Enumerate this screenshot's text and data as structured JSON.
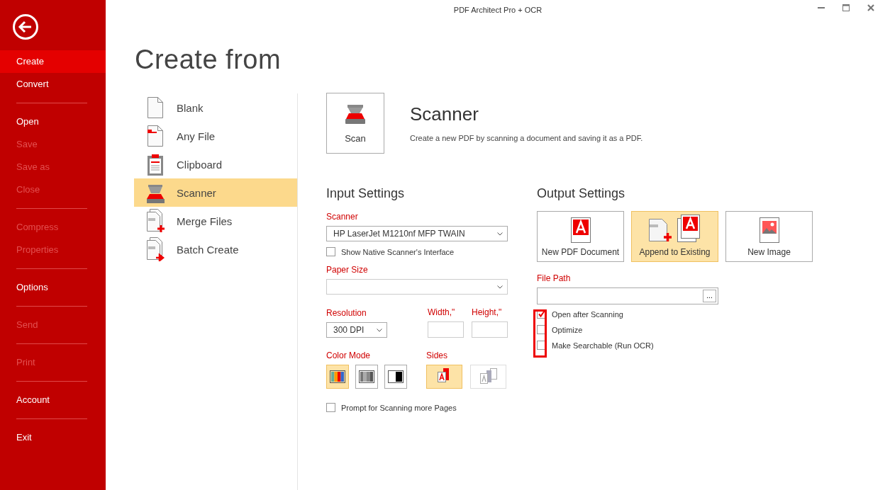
{
  "window": {
    "title": "PDF Architect Pro + OCR"
  },
  "sidebar": {
    "groups": [
      [
        {
          "label": "Create",
          "selected": true,
          "disabled": false
        },
        {
          "label": "Convert",
          "selected": false,
          "disabled": false
        }
      ],
      [
        {
          "label": "Open",
          "selected": false,
          "disabled": false
        },
        {
          "label": "Save",
          "selected": false,
          "disabled": true
        },
        {
          "label": "Save as",
          "selected": false,
          "disabled": true
        },
        {
          "label": "Close",
          "selected": false,
          "disabled": true
        }
      ],
      [
        {
          "label": "Compress",
          "selected": false,
          "disabled": true
        },
        {
          "label": "Properties",
          "selected": false,
          "disabled": true
        }
      ],
      [
        {
          "label": "Options",
          "selected": false,
          "disabled": false
        }
      ],
      [
        {
          "label": "Send",
          "selected": false,
          "disabled": true
        }
      ],
      [
        {
          "label": "Print",
          "selected": false,
          "disabled": true
        }
      ],
      [
        {
          "label": "Account",
          "selected": false,
          "disabled": false
        }
      ],
      [
        {
          "label": "Exit",
          "selected": false,
          "disabled": false
        }
      ]
    ]
  },
  "page_title": "Create from",
  "sources": [
    {
      "kind": "blank",
      "label": "Blank",
      "selected": false
    },
    {
      "kind": "anyfile",
      "label": "Any File",
      "selected": false
    },
    {
      "kind": "clipboard",
      "label": "Clipboard",
      "selected": false
    },
    {
      "kind": "scanner",
      "label": "Scanner",
      "selected": true
    },
    {
      "kind": "merge",
      "label": "Merge Files",
      "selected": false
    },
    {
      "kind": "batch",
      "label": "Batch Create",
      "selected": false
    }
  ],
  "action": {
    "button": "Scan",
    "heading": "Scanner",
    "description": "Create a new PDF by scanning a document and saving it as a PDF."
  },
  "input_settings": {
    "title": "Input Settings",
    "scanner_label": "Scanner",
    "scanner_value": "HP LaserJet M1210nf MFP TWAIN",
    "native_interface": {
      "label": "Show Native Scanner's Interface",
      "checked": false
    },
    "paper_size_label": "Paper Size",
    "resolution_label": "Resolution",
    "resolution_value": "300 DPI",
    "width_label": "Width,\"",
    "height_label": "Height,\"",
    "color_mode_label": "Color Mode",
    "color_modes": [
      {
        "kind": "color",
        "selected": true
      },
      {
        "kind": "gray",
        "selected": false
      },
      {
        "kind": "bw",
        "selected": false
      }
    ],
    "sides_label": "Sides",
    "sides": [
      {
        "kind": "single",
        "selected": true,
        "disabled": false
      },
      {
        "kind": "double",
        "selected": false,
        "disabled": true
      }
    ],
    "prompt_more": {
      "label": "Prompt for Scanning more Pages",
      "checked": false
    }
  },
  "output_settings": {
    "title": "Output Settings",
    "options": [
      {
        "kind": "pdf",
        "label": "New PDF Document",
        "selected": false
      },
      {
        "kind": "append",
        "label": "Append to Existing",
        "selected": true
      },
      {
        "kind": "image",
        "label": "New Image",
        "selected": false
      }
    ],
    "file_path_label": "File Path",
    "browse_button": "...",
    "checkboxes_highlighted": true,
    "checkboxes": [
      {
        "label": "Open after Scanning",
        "checked": true
      },
      {
        "label": "Optimize",
        "checked": false
      },
      {
        "label": "Make Searchable (Run OCR)",
        "checked": false
      }
    ]
  }
}
